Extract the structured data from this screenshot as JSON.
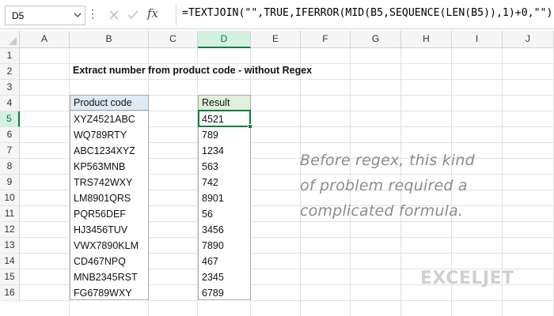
{
  "formula_bar": {
    "name_box": "D5",
    "fx_label": "fx",
    "formula": "=TEXTJOIN(\"\",TRUE,IFERROR(MID(B5,SEQUENCE(LEN(B5)),1)+0,\"\"))"
  },
  "columns": [
    "A",
    "B",
    "C",
    "D",
    "E",
    "F",
    "G",
    "H",
    "I",
    "J"
  ],
  "rows": [
    "1",
    "2",
    "3",
    "4",
    "5",
    "6",
    "7",
    "8",
    "9",
    "10",
    "11",
    "12",
    "13",
    "14",
    "15",
    "16"
  ],
  "sheet": {
    "title": "Extract number from product code - without Regex",
    "product_header": "Product code",
    "result_header": "Result",
    "product_codes": [
      "XYZ4521ABC",
      "WQ789RTY",
      "ABC1234XYZ",
      "KP563MNB",
      "TRS742WXY",
      "LM8901QRS",
      "PQR56DEF",
      "HJ3456TUV",
      "VWX7890KLM",
      "CD467NPQ",
      "MNB2345RST",
      "FG6789WXY"
    ],
    "results": [
      "4521",
      "789",
      "1234",
      "563",
      "742",
      "8901",
      "56",
      "3456",
      "7890",
      "467",
      "2345",
      "6789"
    ]
  },
  "note": {
    "lines": [
      "Before regex, this kind",
      "of problem required a",
      "complicated formula."
    ]
  },
  "logo": {
    "text": "EXCELJET"
  },
  "colors": {
    "accent": "#107c41",
    "header_blue": "#deebf7",
    "header_green": "#e2efda"
  }
}
